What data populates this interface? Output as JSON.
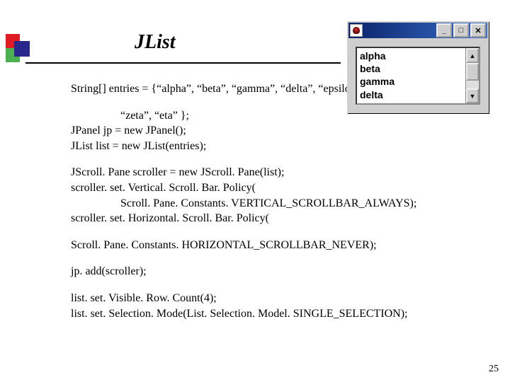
{
  "title": "JList",
  "code": {
    "l1": "String[] entries = {“alpha”, “beta”, “gamma”, “delta”, “epsilon”,",
    "l2": "“zeta”, “eta” };",
    "l3": "JPanel jp = new JPanel();",
    "l4": "JList list = new JList(entries);",
    "l5": "JScroll. Pane scroller = new JScroll. Pane(list);",
    "l6": "scroller. set. Vertical. Scroll. Bar. Policy(",
    "l7": "Scroll. Pane. Constants. VERTICAL_SCROLLBAR_ALWAYS);",
    "l8": "scroller. set. Horizontal. Scroll. Bar. Policy(",
    "l9": "Scroll. Pane. Constants. HORIZONTAL_SCROLLBAR_NEVER);",
    "l10": "jp. add(scroller);",
    "l11": "list. set. Visible. Row. Count(4);",
    "l12": "list. set. Selection. Mode(List. Selection. Model. SINGLE_SELECTION);"
  },
  "window": {
    "buttons": {
      "min": "_",
      "max": "□",
      "close": "✕"
    },
    "scrollbar": {
      "up": "▲",
      "down": "▼"
    },
    "list_items": [
      "alpha",
      "beta",
      "gamma",
      "delta"
    ]
  },
  "page_number": "25"
}
